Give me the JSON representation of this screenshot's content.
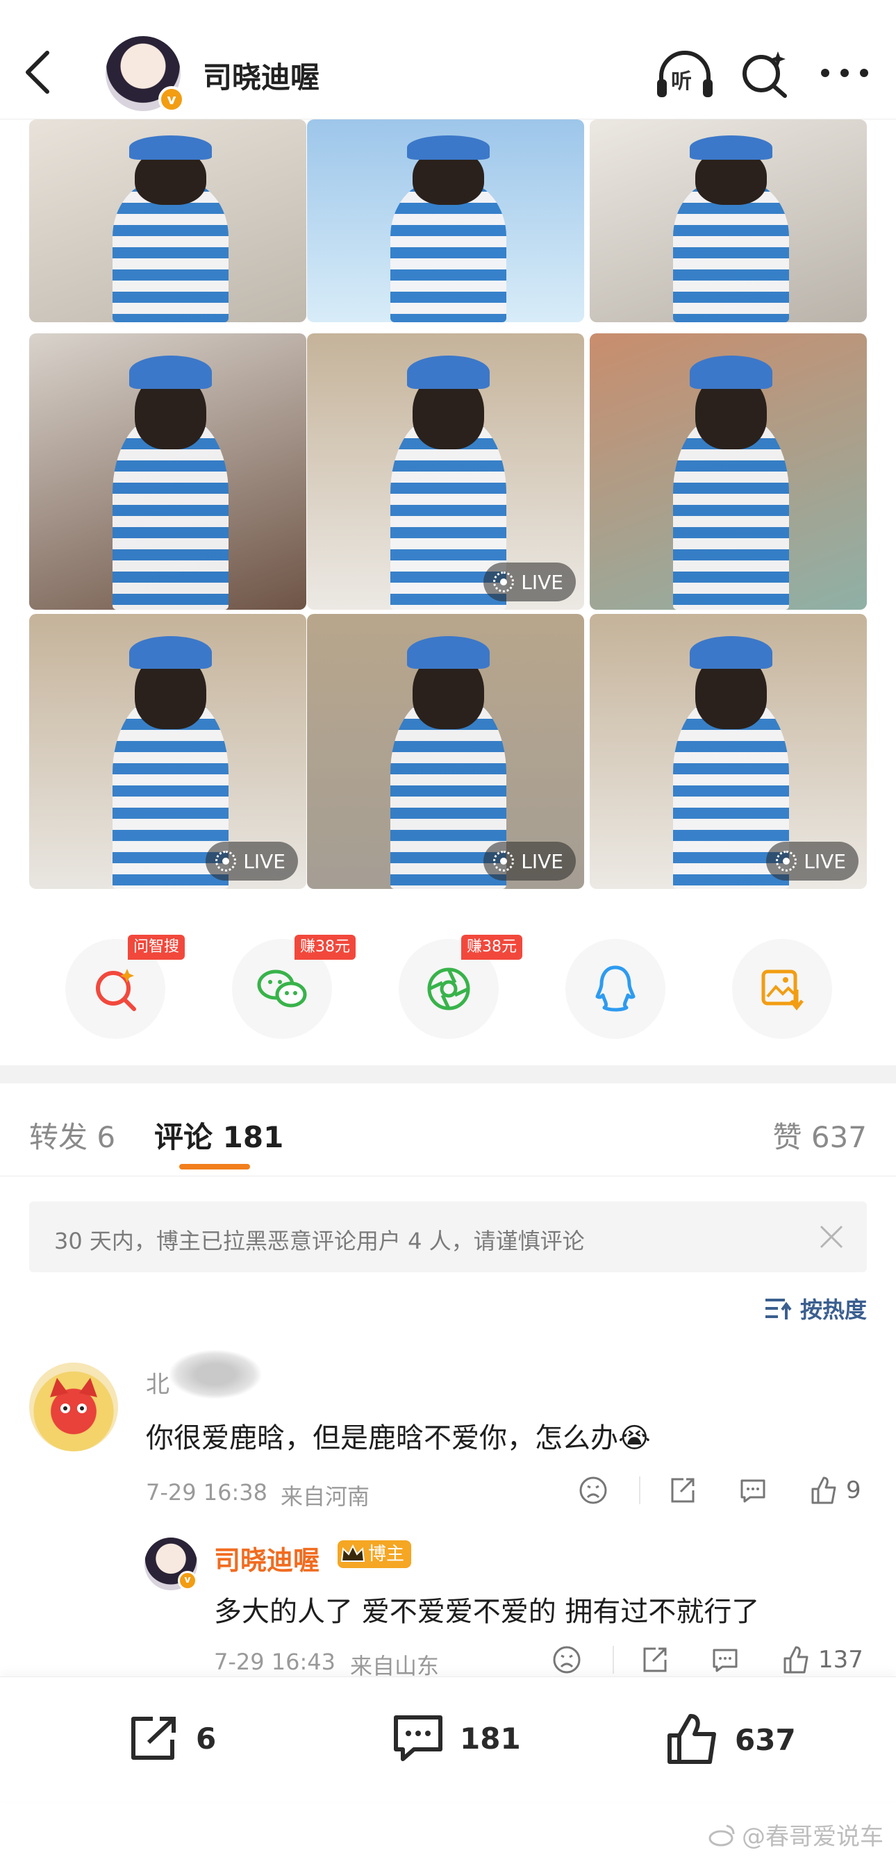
{
  "header": {
    "title": "司晓迪喔",
    "listen_label": "听",
    "verified_mark": "v"
  },
  "colors": {
    "accent": "#f27f1c",
    "live_badge": "#282828",
    "reply_name": "#f16c20",
    "tag_red": "#f2483c",
    "link_blue": "#3b5f8f"
  },
  "photos": [
    {
      "live": false,
      "bg": "linear-gradient(160deg,#e8e2da,#bfb8ad)"
    },
    {
      "live": false,
      "bg": "linear-gradient(180deg,#9dc6ea,#d8ecf8)"
    },
    {
      "live": false,
      "bg": "linear-gradient(160deg,#ece8e2,#b9b3aa)"
    },
    {
      "live": false,
      "bg": "linear-gradient(160deg,#d9d3cc,#6e5446)"
    },
    {
      "live": true,
      "bg": "linear-gradient(180deg,#c5b39a,#ece9e4)"
    },
    {
      "live": false,
      "bg": "linear-gradient(160deg,#c98d6d,#8fb0a6)"
    },
    {
      "live": true,
      "bg": "linear-gradient(180deg,#c5b39a,#e9e6e1)"
    },
    {
      "live": true,
      "bg": "linear-gradient(180deg,#b8a68c,#a59e94)"
    },
    {
      "live": true,
      "bg": "linear-gradient(180deg,#c5b39a,#ece9e4)"
    }
  ],
  "live_label": "LIVE",
  "share": [
    {
      "icon": "ai-search-icon",
      "tag": "问智搜"
    },
    {
      "icon": "wechat-icon",
      "tag": "赚38元"
    },
    {
      "icon": "moments-icon",
      "tag": "赚38元"
    },
    {
      "icon": "qq-icon",
      "tag": ""
    },
    {
      "icon": "save-image-icon",
      "tag": ""
    }
  ],
  "tabs": {
    "repost": "转发 6",
    "comments": "评论 181",
    "likes": "赞 637"
  },
  "notice": {
    "text": "30 天内，博主已拉黑恶意评论用户 4 人，请谨慎评论"
  },
  "sort": {
    "label": "按热度"
  },
  "comment": {
    "name_partial": "北",
    "text": "你很爱鹿晗，但是鹿晗不爱你，怎么办😭",
    "time": "7-29 16:38",
    "location": "来自河南",
    "likes": "9"
  },
  "reply": {
    "name": "司晓迪喔",
    "badge": "博主",
    "text": "多大的人了 爱不爱爱不爱的 拥有过不就行了",
    "time": "7-29 16:43",
    "location": "来自山东",
    "likes": "137"
  },
  "bottom": {
    "reposts": "6",
    "comments": "181",
    "likes": "637"
  },
  "watermark": "@春哥爱说车"
}
